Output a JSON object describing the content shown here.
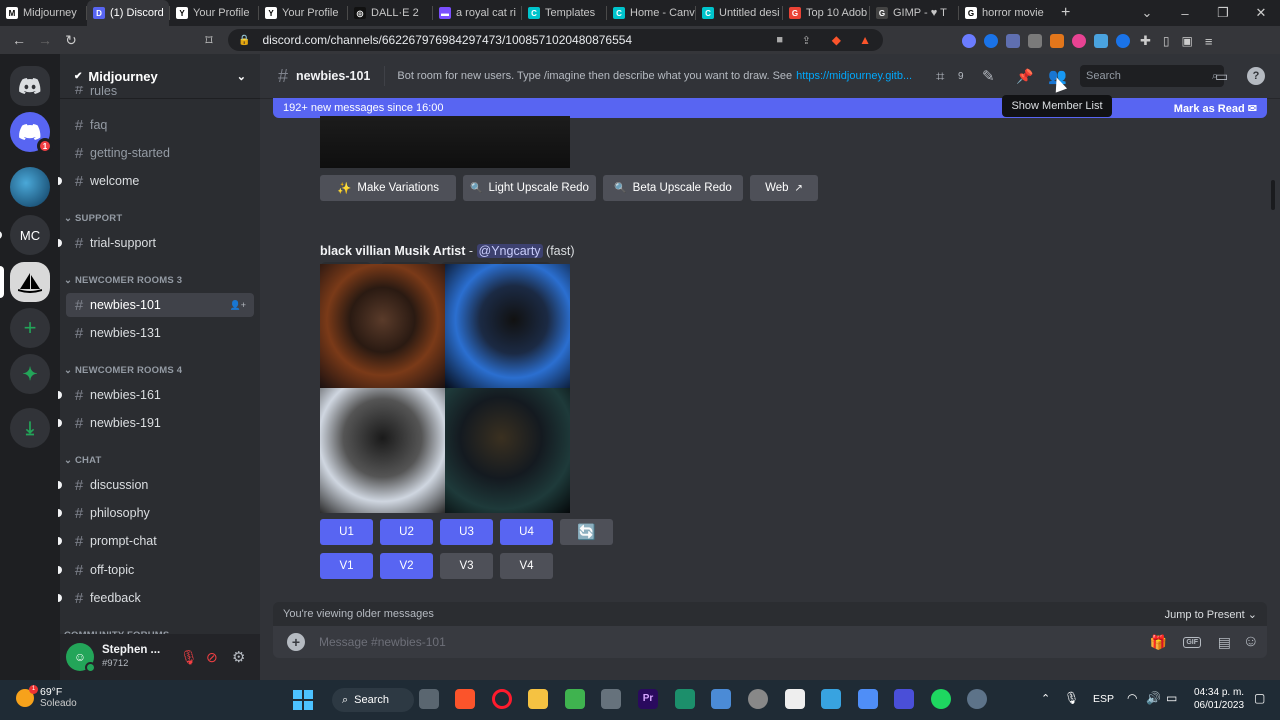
{
  "browser": {
    "tabs": [
      {
        "title": "Midjourney",
        "color": "#ffffff",
        "glyph": "M"
      },
      {
        "title": "(1) Discord",
        "color": "#5865f2",
        "glyph": "D",
        "active": true
      },
      {
        "title": "Your Profile",
        "color": "#ffffff",
        "glyph": "Y"
      },
      {
        "title": "Your Profile",
        "color": "#ffffff",
        "glyph": "Y"
      },
      {
        "title": "DALL·E 2",
        "color": "#111111",
        "glyph": "◎"
      },
      {
        "title": "a royal cat ri",
        "color": "#7b4fff",
        "glyph": "▬"
      },
      {
        "title": "Templates",
        "color": "#00c4cc",
        "glyph": "C"
      },
      {
        "title": "Home - Canv",
        "color": "#00c4cc",
        "glyph": "C"
      },
      {
        "title": "Untitled desi",
        "color": "#00c4cc",
        "glyph": "C"
      },
      {
        "title": "Top 10 Adob",
        "color": "#ea4335",
        "glyph": "G"
      },
      {
        "title": "GIMP - ♥ T",
        "color": "#444444",
        "glyph": "G"
      },
      {
        "title": "horror movie",
        "color": "#ffffff",
        "glyph": "G"
      }
    ],
    "url": "discord.com/channels/662267976984297473/1008571020480876554"
  },
  "server": {
    "name": "Midjourney",
    "channels_top": [
      "rules",
      "faq",
      "getting-started",
      "welcome"
    ],
    "cat_support": "SUPPORT",
    "support": [
      "trial-support"
    ],
    "cat_newcomer3": "NEWCOMER ROOMS 3",
    "newcomer3": [
      "newbies-101",
      "newbies-131"
    ],
    "cat_newcomer4": "NEWCOMER ROOMS 4",
    "newcomer4": [
      "newbies-161",
      "newbies-191"
    ],
    "cat_chat": "CHAT",
    "chat": [
      "discussion",
      "philosophy",
      "prompt-chat",
      "off-topic",
      "feedback"
    ],
    "cat_forums": "COMMUNITY FORUMS"
  },
  "guild_icons": {
    "mc": "MC",
    "badge": "1"
  },
  "user": {
    "name": "Stephen ...",
    "tag": "#9712"
  },
  "channel": {
    "name": "newbies-101",
    "topic": "Bot room for new users. Type /imagine then describe what you want to draw. See",
    "topic_link": "https://midjourney.gitb...",
    "threads_count": "9",
    "search_placeholder": "Search"
  },
  "banner": {
    "text": "192+ new messages since 16:00",
    "mark_read": "Mark as Read"
  },
  "tooltip": "Show Member List",
  "message": {
    "buttons": [
      "Make Variations",
      "Light Upscale Redo",
      "Beta Upscale Redo",
      "Web"
    ],
    "reactions": [
      "😣",
      "😑",
      "😃",
      "😍"
    ],
    "prompt": "black villian Musik Artist",
    "dash": " - ",
    "mention": "@Yngcarty",
    "speed": "(fast)",
    "upscale": [
      "U1",
      "U2",
      "U3",
      "U4"
    ],
    "variation": [
      "V1",
      "V2",
      "V3",
      "V4"
    ]
  },
  "older": {
    "text": "You're viewing older messages",
    "jump": "Jump to Present"
  },
  "composer": {
    "placeholder": "Message #newbies-101"
  },
  "taskbar": {
    "weather_temp": "69°F",
    "weather_desc": "Soleado",
    "search": "Search",
    "lang": "ESP",
    "time": "04:34 p. m.",
    "date": "06/01/2023"
  }
}
